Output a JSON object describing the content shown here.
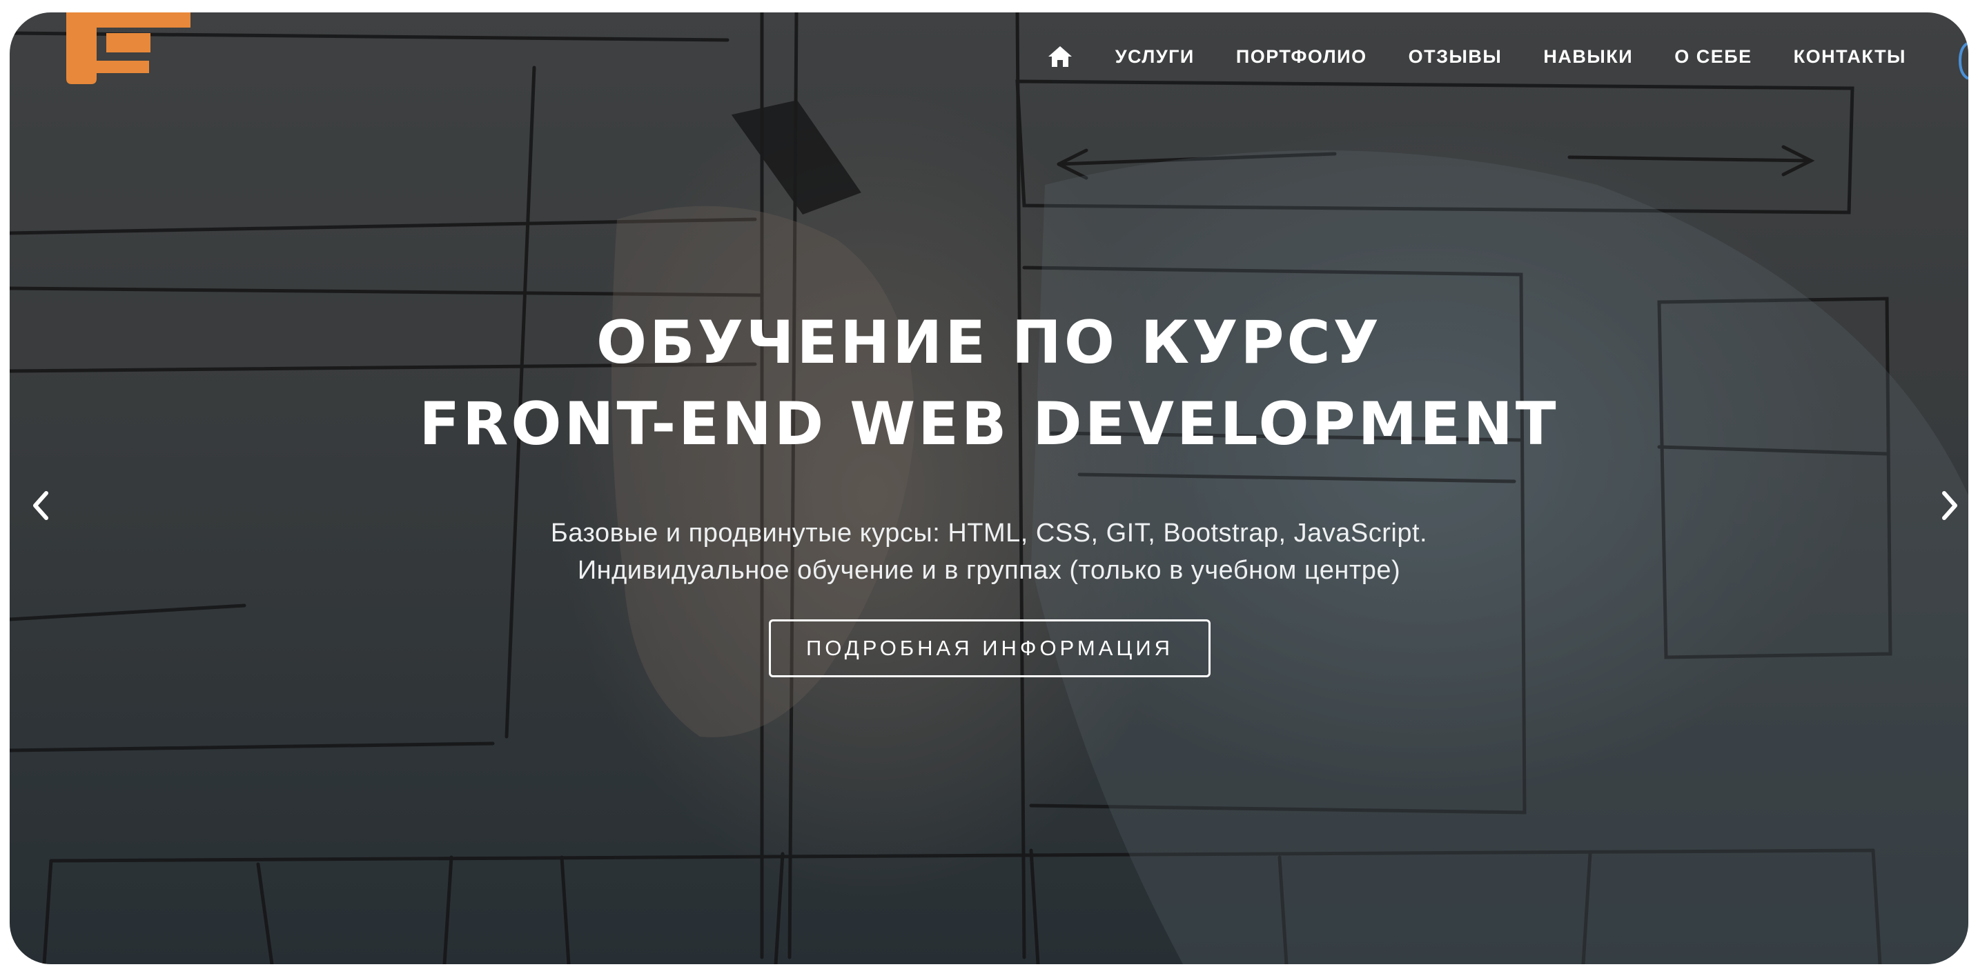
{
  "nav": {
    "items": [
      {
        "label": "УСЛУГИ"
      },
      {
        "label": "ПОРТФОЛИО"
      },
      {
        "label": "ОТЗЫВЫ"
      },
      {
        "label": "НАВЫКИ"
      },
      {
        "label": "О СЕБЕ"
      },
      {
        "label": "КОНТАКТЫ"
      }
    ],
    "home_icon": "home-icon"
  },
  "hero": {
    "title_line1": "ОБУЧЕНИЕ ПО КУРСУ",
    "title_line2": "FRONT-END WEB DEVELOPMENT",
    "subtitle_line1": "Базовые и продвинутые курсы: HTML, CSS, GIT, Bootstrap, JavaScript.",
    "subtitle_line2": "Индивидуальное обучение и в группах (только в учебном центре)",
    "cta_label": "ПОДРОБНАЯ ИНФОРМАЦИЯ"
  },
  "carousel": {
    "prev_icon": "chevron-left-icon",
    "next_icon": "chevron-right-icon"
  },
  "colors": {
    "logo_orange": "#e8883a",
    "text": "#ffffff"
  }
}
